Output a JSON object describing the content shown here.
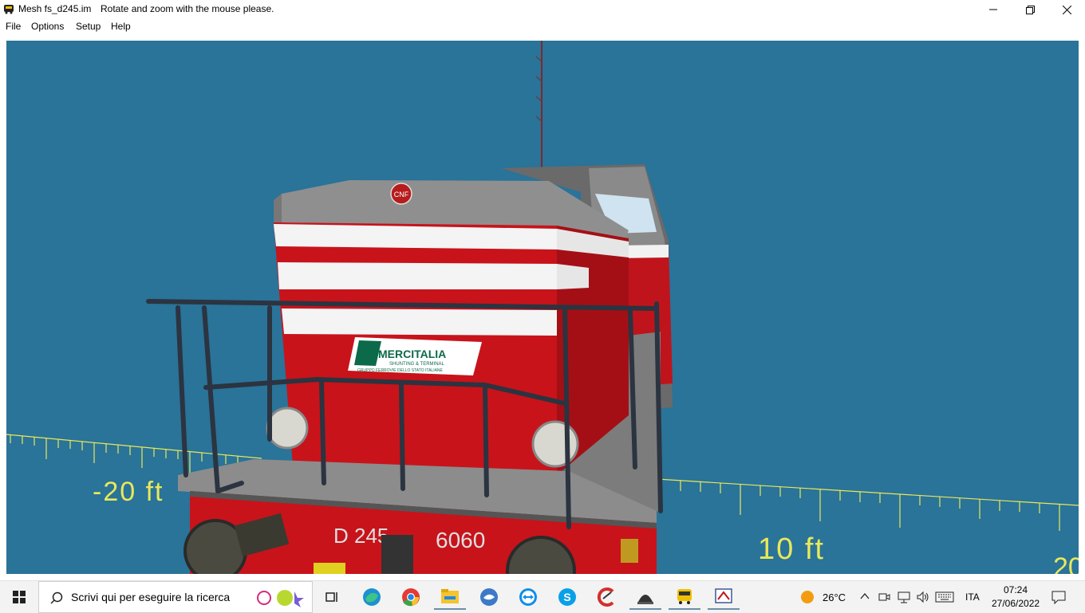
{
  "window": {
    "title": "Mesh fs_d245.im",
    "hint": "Rotate and zoom with the mouse please."
  },
  "menu": [
    "File",
    "Options",
    "Setup",
    "Help"
  ],
  "viewport": {
    "ruler_left_label": "-20 ft",
    "ruler_right_label": "10 ft",
    "ruler_far_label": "20",
    "loco_number_left": "D 245",
    "loco_number_right": "6060",
    "logo_brand": "MERCITALIA",
    "logo_sub": "SHUNTING & TERMINAL",
    "logo_group": "GRUPPO FERROVIE DELLO STATO ITALIANE",
    "badge": "CNF",
    "bg_color": "#2a7399",
    "ruler_color": "#e8e85a"
  },
  "taskbar": {
    "search_placeholder": "Scrivi qui per eseguire la ricerca",
    "weather": "26°C",
    "language": "ITA",
    "time": "07:24",
    "date": "27/06/2022",
    "apps": [
      "task-view",
      "edge",
      "chrome",
      "file-explorer",
      "app-bird",
      "teamviewer",
      "skype",
      "ccleaner",
      "cap-app",
      "bus-app",
      "mesh-tool"
    ]
  }
}
